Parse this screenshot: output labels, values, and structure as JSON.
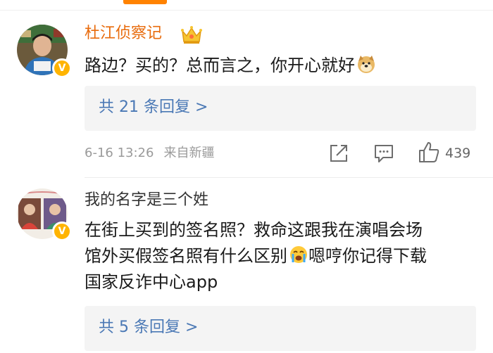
{
  "comments": [
    {
      "username": "杜江侦察记",
      "text": "路边？买的？总而言之，你开心就好",
      "emoji_icon": "doge-icon",
      "replies_label": "共 21 条回复 >",
      "date": "6-16 13:26",
      "source": "来自新疆",
      "like_count": "439",
      "verified_badge": "V"
    },
    {
      "username": "我的名字是三个姓",
      "text_line1": "在街上买到的签名照？救命这跟我在演唱会场",
      "text_line2a": "馆外买假签名照有什么区别",
      "text_line2b": "嗯哼你记得下载",
      "text_line3": "国家反诈中心app",
      "emoji_icon": "crying-face-icon",
      "replies_label": "共 5 条回复 >",
      "verified_badge": "V"
    }
  ],
  "colors": {
    "accent": "#ff8200",
    "username_highlight": "#e86b0c",
    "link": "#4a78b5",
    "badge": "#ffb400"
  }
}
